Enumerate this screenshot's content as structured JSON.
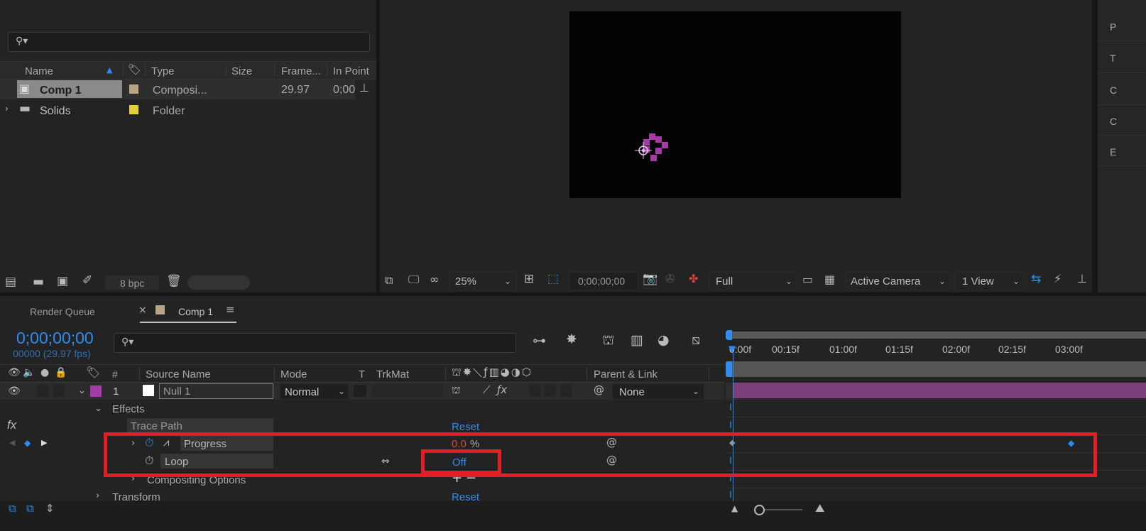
{
  "project": {
    "search_placeholder": "",
    "columns": [
      "Name",
      "Type",
      "Size",
      "Frame...",
      "In Point"
    ],
    "rows": [
      {
        "name": "Comp 1",
        "type": "Composi...",
        "size": "",
        "frame_rate": "29.97",
        "in_point": "0;00",
        "label_color": "#b9a583"
      },
      {
        "name": "Solids",
        "type": "Folder",
        "size": "",
        "frame_rate": "",
        "in_point": "",
        "label_color": "#e6cf3f"
      }
    ],
    "bpc": "8 bpc"
  },
  "viewer": {
    "zoom": "25%",
    "timecode": "0;00;00;00",
    "resolution": "Full",
    "camera": "Active Camera",
    "views": "1 View"
  },
  "right_panel": {
    "letters": [
      "P",
      "T",
      "C",
      "C",
      "E"
    ]
  },
  "timeline": {
    "tabs": {
      "render_queue": "Render Queue",
      "comp": "Comp 1"
    },
    "current_time": "0;00;00;00",
    "frame_info": "00000 (29.97 fps)",
    "search_placeholder": "",
    "columns": {
      "number": "#",
      "source_name": "Source Name",
      "mode": "Mode",
      "t": "T",
      "trkmat": "TrkMat",
      "parent": "Parent & Link"
    },
    "ruler_labels": [
      "0:00f",
      "00:15f",
      "01:00f",
      "01:15f",
      "02:00f",
      "02:15f",
      "03:00f"
    ],
    "layer": {
      "number": "1",
      "name": "Null 1",
      "mode": "Normal",
      "parent": "None",
      "label_color": "#a43aa6"
    },
    "effects_label": "Effects",
    "effect_name": "Trace Path",
    "reset_label": "Reset",
    "progress": {
      "label": "Progress",
      "value": "0.0",
      "unit": "%"
    },
    "loop": {
      "label": "Loop",
      "value": "Off"
    },
    "compositing_options": "Compositing Options",
    "transform": {
      "label": "Transform",
      "reset": "Reset"
    },
    "fx_label": "fx"
  },
  "colors": {
    "accent_blue": "#2f8cf0",
    "highlight_red": "#e31d25",
    "layer_bar": "#7a3f7a",
    "null_shape": "#a43aa6"
  }
}
